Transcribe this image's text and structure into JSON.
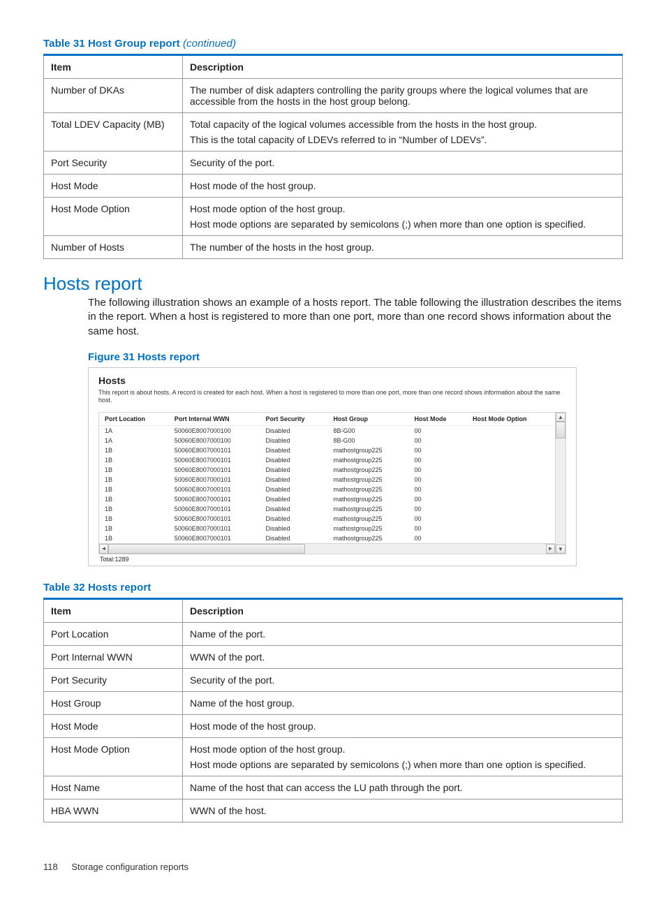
{
  "table31": {
    "caption_prefix": "Table 31 Host Group report",
    "caption_suffix": " (continued)",
    "headers": {
      "item": "Item",
      "desc": "Description"
    },
    "rows": [
      {
        "item": "Number of DKAs",
        "desc": [
          "The number of disk adapters controlling the parity groups where the logical volumes that are accessible from the hosts in the host group belong."
        ]
      },
      {
        "item": "Total LDEV Capacity (MB)",
        "desc": [
          "Total capacity of the logical volumes accessible from the hosts in the host group.",
          "This is the total capacity of LDEVs referred to in “Number of LDEVs”."
        ]
      },
      {
        "item": "Port Security",
        "desc": [
          "Security of the port."
        ]
      },
      {
        "item": "Host Mode",
        "desc": [
          "Host mode of the host group."
        ]
      },
      {
        "item": "Host Mode Option",
        "desc": [
          "Host mode option of the host group.",
          "Host mode options are separated by semicolons (;) when more than one option is specified."
        ]
      },
      {
        "item": "Number of Hosts",
        "desc": [
          "The number of the hosts in the host group."
        ]
      }
    ]
  },
  "section": {
    "heading": "Hosts report",
    "body": "The following illustration shows an example of a hosts report. The table following the illustration describes the items in the report. When a host is registered to more than one port, more than one record shows information about the same host."
  },
  "figure31": {
    "caption": "Figure 31 Hosts report",
    "title": "Hosts",
    "desc": "This report is about hosts. A record is created for each host. When a host is registered to more than one port, more than one record shows information about the same host.",
    "columns": [
      "Port Location",
      "Port Internal WWN",
      "Port Security",
      "Host Group",
      "Host Mode",
      "Host Mode Option"
    ],
    "rows": [
      [
        "1A",
        "50060E8007000100",
        "Disabled",
        "8B-G00",
        "00",
        ""
      ],
      [
        "1A",
        "50060E8007000100",
        "Disabled",
        "8B-G00",
        "00",
        ""
      ],
      [
        "1B",
        "50060E8007000101",
        "Disabled",
        "mathostgroup225",
        "00",
        ""
      ],
      [
        "1B",
        "50060E8007000101",
        "Disabled",
        "mathostgroup225",
        "00",
        ""
      ],
      [
        "1B",
        "50060E8007000101",
        "Disabled",
        "mathostgroup225",
        "00",
        ""
      ],
      [
        "1B",
        "50060E8007000101",
        "Disabled",
        "mathostgroup225",
        "00",
        ""
      ],
      [
        "1B",
        "50060E8007000101",
        "Disabled",
        "mathostgroup225",
        "00",
        ""
      ],
      [
        "1B",
        "50060E8007000101",
        "Disabled",
        "mathostgroup225",
        "00",
        ""
      ],
      [
        "1B",
        "50060E8007000101",
        "Disabled",
        "mathostgroup225",
        "00",
        ""
      ],
      [
        "1B",
        "50060E8007000101",
        "Disabled",
        "mathostgroup225",
        "00",
        ""
      ],
      [
        "1B",
        "50060E8007000101",
        "Disabled",
        "mathostgroup225",
        "00",
        ""
      ],
      [
        "1B",
        "50060E8007000101",
        "Disabled",
        "mathostgroup225",
        "00",
        ""
      ]
    ],
    "total": "Total:1289"
  },
  "table32": {
    "caption": "Table 32 Hosts report",
    "headers": {
      "item": "Item",
      "desc": "Description"
    },
    "rows": [
      {
        "item": "Port Location",
        "desc": [
          "Name of the port."
        ]
      },
      {
        "item": "Port Internal WWN",
        "desc": [
          "WWN of the port."
        ]
      },
      {
        "item": "Port Security",
        "desc": [
          "Security of the port."
        ]
      },
      {
        "item": "Host Group",
        "desc": [
          "Name of the host group."
        ]
      },
      {
        "item": "Host Mode",
        "desc": [
          "Host mode of the host group."
        ]
      },
      {
        "item": "Host Mode Option",
        "desc": [
          "Host mode option of the host group.",
          "Host mode options are separated by semicolons (;) when more than one option is specified."
        ]
      },
      {
        "item": "Host Name",
        "desc": [
          "Name of the host that can access the LU path through the port."
        ]
      },
      {
        "item": "HBA WWN",
        "desc": [
          "WWN of the host."
        ]
      }
    ]
  },
  "footer": {
    "page": "118",
    "section": "Storage configuration reports"
  }
}
